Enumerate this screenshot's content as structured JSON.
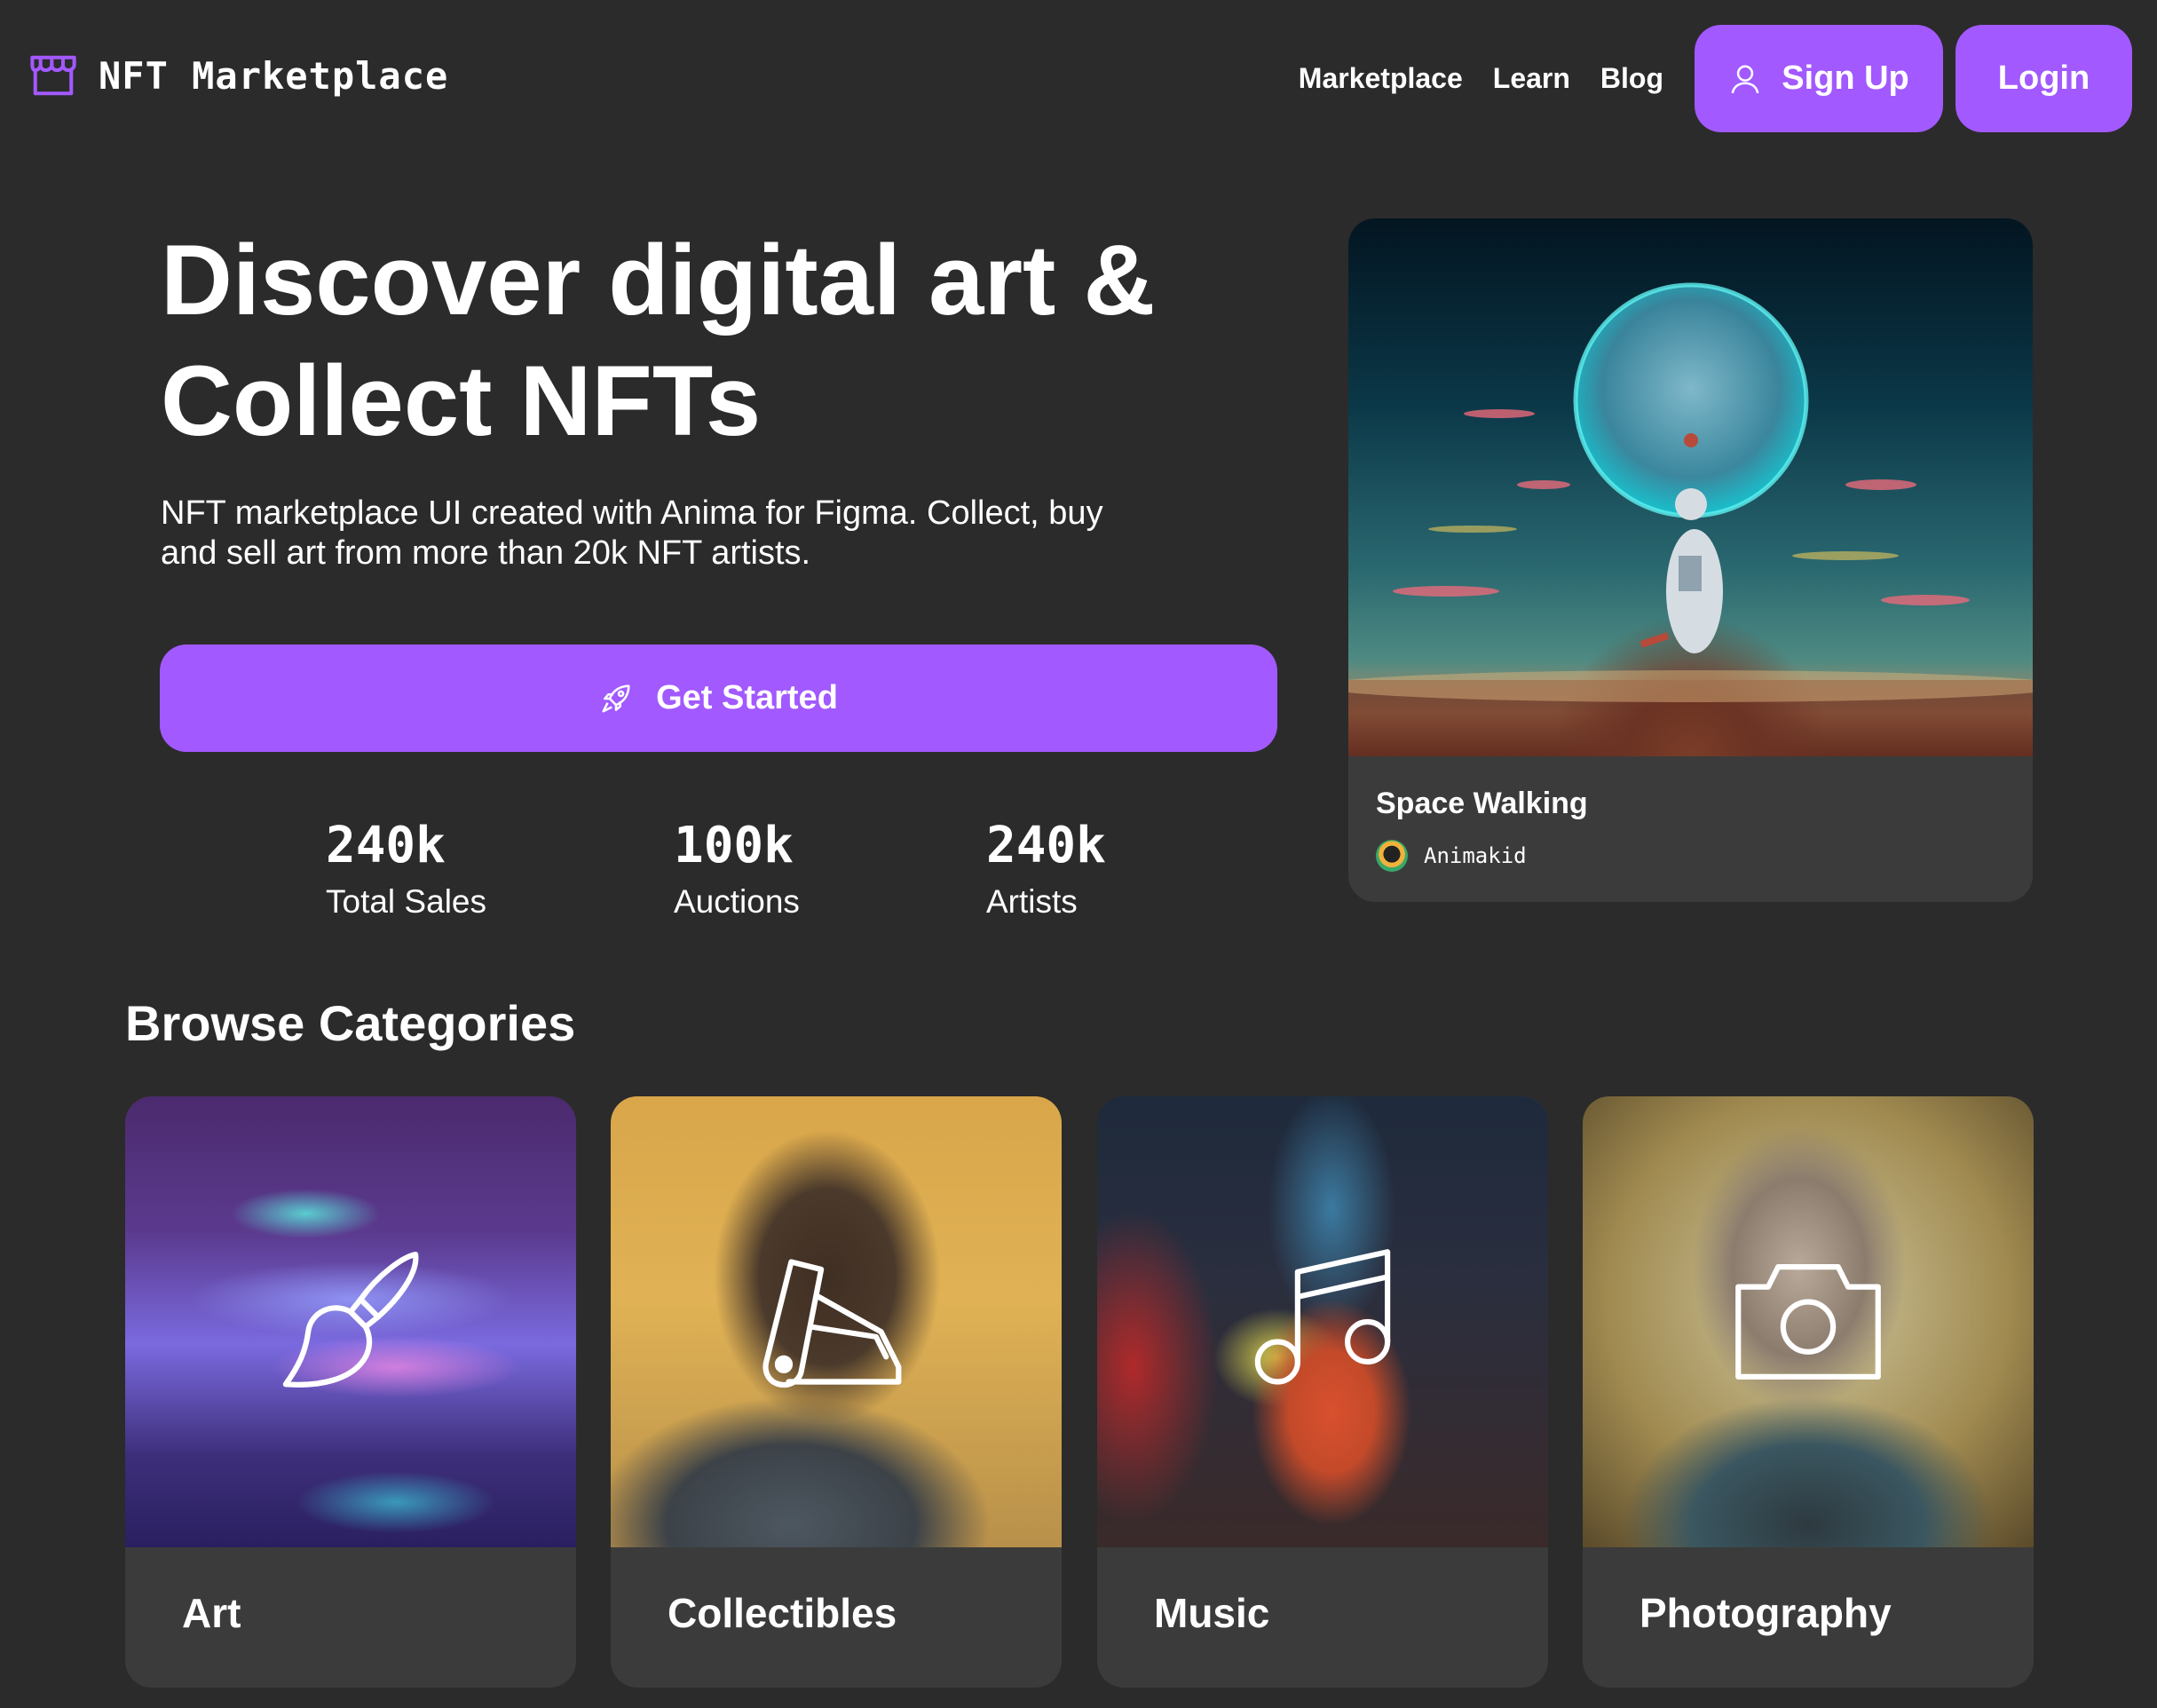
{
  "header": {
    "logo_text": "NFT Marketplace",
    "nav": [
      "Marketplace",
      "Learn",
      "Blog"
    ],
    "signup_label": "Sign Up",
    "login_label": "Login"
  },
  "hero": {
    "title_line1": "Discover digital art &",
    "title_line2": "Collect NFTs",
    "subtitle_line1": "NFT marketplace UI created with Anima for Figma. Collect, buy",
    "subtitle_line2": "and sell art from more than 20k NFT artists.",
    "cta_label": "Get Started",
    "stats": [
      {
        "value": "240k",
        "label": "Total Sales"
      },
      {
        "value": "100k",
        "label": "Auctions"
      },
      {
        "value": "240k",
        "label": "Artists"
      }
    ]
  },
  "featured": {
    "title": "Space Walking",
    "artist": "Animakid"
  },
  "categories": {
    "title": "Browse Categories",
    "items": [
      {
        "label": "Art",
        "icon": "paintbrush-icon"
      },
      {
        "label": "Collectibles",
        "icon": "swatches-icon"
      },
      {
        "label": "Music",
        "icon": "music-notes-icon"
      },
      {
        "label": "Photography",
        "icon": "camera-icon"
      }
    ]
  },
  "colors": {
    "accent": "#a259ff",
    "background": "#2b2b2b",
    "card": "#3b3b3b"
  }
}
